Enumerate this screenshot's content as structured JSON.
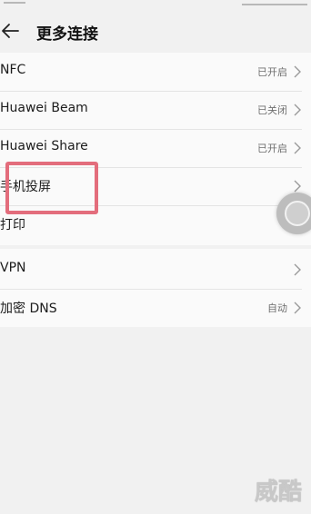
{
  "header": {
    "title": "更多连接"
  },
  "section1": {
    "items": [
      {
        "label": "NFC",
        "status": "已开启"
      },
      {
        "label": "Huawei Beam",
        "status": "已关闭"
      },
      {
        "label": "Huawei Share",
        "status": "已开启"
      },
      {
        "label": "手机投屏",
        "status": ""
      },
      {
        "label": "打印",
        "status": ""
      }
    ]
  },
  "section2": {
    "items": [
      {
        "label": "VPN",
        "status": ""
      },
      {
        "label": "加密 DNS",
        "status": "自动"
      }
    ]
  },
  "watermark": "威酷",
  "colors": {
    "highlight": "#e36d7c",
    "background": "#f1f1f1"
  }
}
